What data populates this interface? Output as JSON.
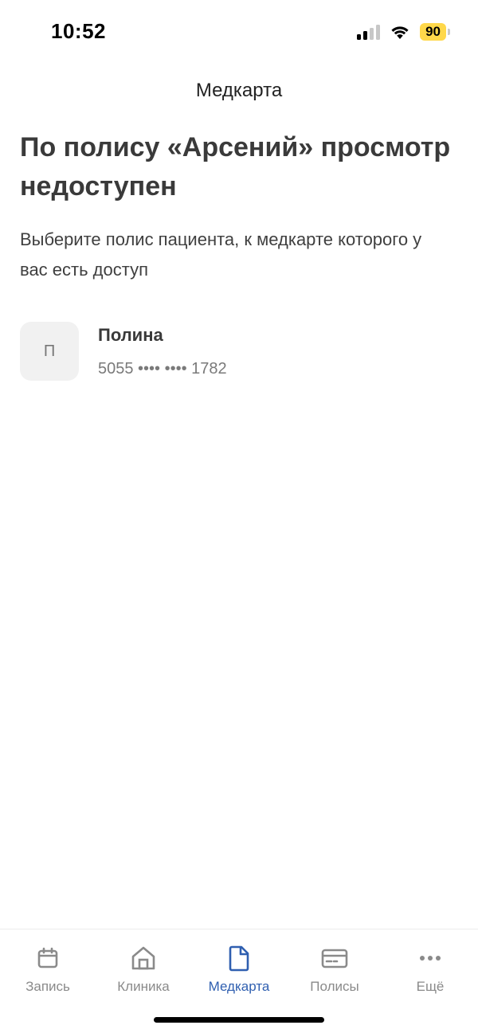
{
  "status_bar": {
    "time": "10:52",
    "battery": "90",
    "icons": [
      "signal-icon",
      "wifi-icon",
      "battery-icon"
    ]
  },
  "header": {
    "title": "Медкарта"
  },
  "main": {
    "headline": "По полису «Арсений» просмотр недоступен",
    "subtitle": "Выберите полис пациента, к медкарте которого у вас есть доступ",
    "policies": [
      {
        "initial": "П",
        "name": "Полина",
        "number": "5055 •••• •••• 1782"
      }
    ]
  },
  "tab_bar": {
    "active": "Медкарта",
    "tabs": [
      {
        "label": "Запись",
        "icon": "calendar-icon"
      },
      {
        "label": "Клиника",
        "icon": "home-icon"
      },
      {
        "label": "Медкарта",
        "icon": "document-icon"
      },
      {
        "label": "Полисы",
        "icon": "card-icon"
      },
      {
        "label": "Ещё",
        "icon": "more-icon"
      }
    ]
  },
  "colors": {
    "accent": "#2f5fb0",
    "battery": "#ffd84a",
    "text": "#3a3a3a",
    "muted": "#8a8a8a"
  }
}
